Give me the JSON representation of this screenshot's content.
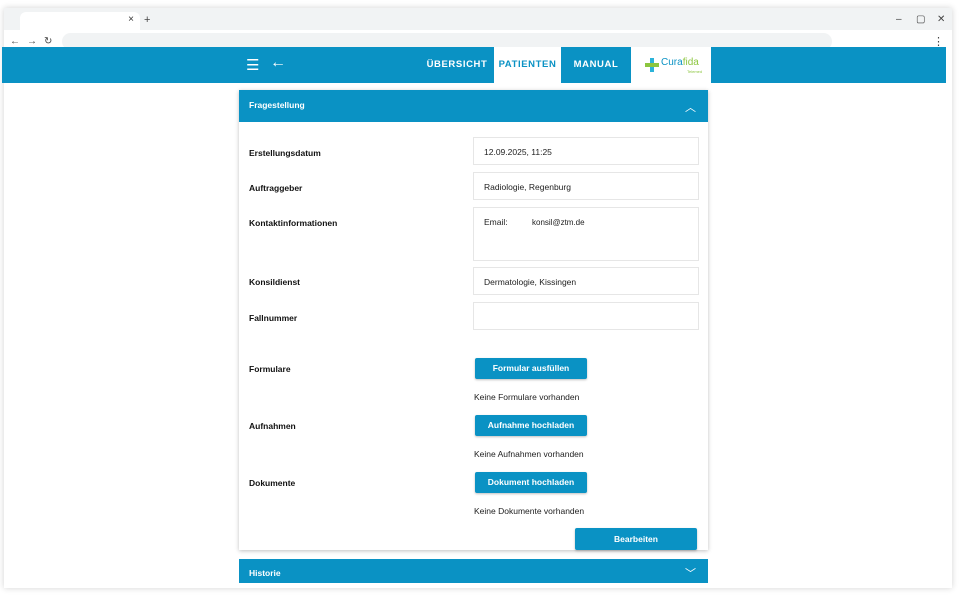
{
  "browser": {
    "tab_close": "×",
    "new_tab": "+",
    "minimize": "–",
    "restore": "▢",
    "close": "✕",
    "back": "←",
    "forward": "→",
    "reload": "↻",
    "menu": "⋮"
  },
  "appbar": {
    "nav": [
      "ÜBERSICHT",
      "PATIENTEN",
      "MANUAL"
    ],
    "active": "PATIENTEN",
    "logo_main": "Cura",
    "logo_accent": "fida",
    "logo_sub": "Telemed",
    "accent_color": "#0a92c4"
  },
  "panel": {
    "title": "Fragestellung",
    "fields": [
      {
        "label": "Erstellungsdatum",
        "value": "12.09.2025, 11:25"
      },
      {
        "label": "Auftraggeber",
        "value": "Radiologie, Regenburg"
      },
      {
        "label": "Kontaktinformationen",
        "email_label": "Email:",
        "email_value": "konsil@ztm.de"
      },
      {
        "label": "Konsildienst",
        "value": "Dermatologie, Kissingen"
      },
      {
        "label": "Fallnummer",
        "value": ""
      }
    ],
    "sections": [
      {
        "label": "Formulare",
        "button": "Formular ausfüllen",
        "empty": "Keine Formulare vorhanden"
      },
      {
        "label": "Aufnahmen",
        "button": "Aufnahme hochladen",
        "empty": "Keine Aufnahmen vorhanden"
      },
      {
        "label": "Dokumente",
        "button": "Dokument hochladen",
        "empty": "Keine Dokumente vorhanden"
      }
    ],
    "edit_button": "Bearbeiten"
  },
  "panel2": {
    "title": "Historie"
  }
}
